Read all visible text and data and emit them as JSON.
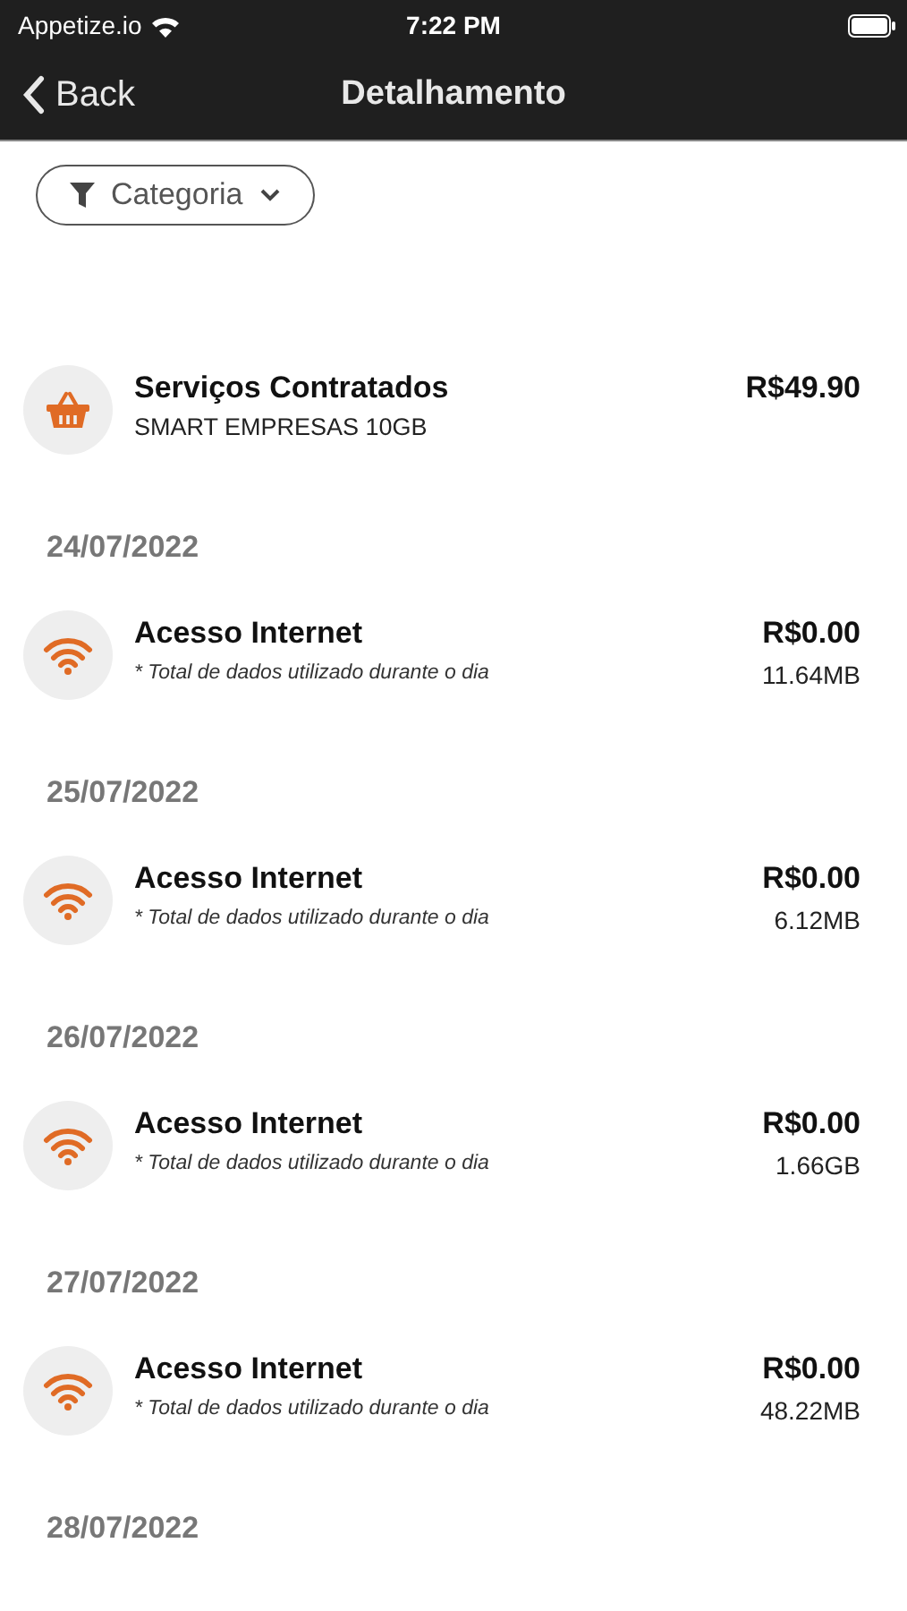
{
  "status_bar": {
    "carrier": "Appetize.io",
    "time": "7:22 PM"
  },
  "nav_bar": {
    "back": "Back",
    "title": "Detalhamento"
  },
  "filter": {
    "label": "Categoria"
  },
  "service": {
    "kind": "basket",
    "title": "Serviços Contratados",
    "subtitle": "SMART EMPRESAS 10GB",
    "amount": "R$49.90"
  },
  "days": [
    {
      "date": "24/07/2022",
      "item": {
        "kind": "wifi",
        "title": "Acesso Internet",
        "note": "* Total de dados utilizado durante o dia",
        "amount": "R$0.00",
        "usage": "11.64MB"
      }
    },
    {
      "date": "25/07/2022",
      "item": {
        "kind": "wifi",
        "title": "Acesso Internet",
        "note": "* Total de dados utilizado durante o dia",
        "amount": "R$0.00",
        "usage": "6.12MB"
      }
    },
    {
      "date": "26/07/2022",
      "item": {
        "kind": "wifi",
        "title": "Acesso Internet",
        "note": "* Total de dados utilizado durante o dia",
        "amount": "R$0.00",
        "usage": "1.66GB"
      }
    },
    {
      "date": "27/07/2022",
      "item": {
        "kind": "wifi",
        "title": "Acesso Internet",
        "note": "* Total de dados utilizado durante o dia",
        "amount": "R$0.00",
        "usage": "48.22MB"
      }
    },
    {
      "date": "28/07/2022"
    }
  ]
}
